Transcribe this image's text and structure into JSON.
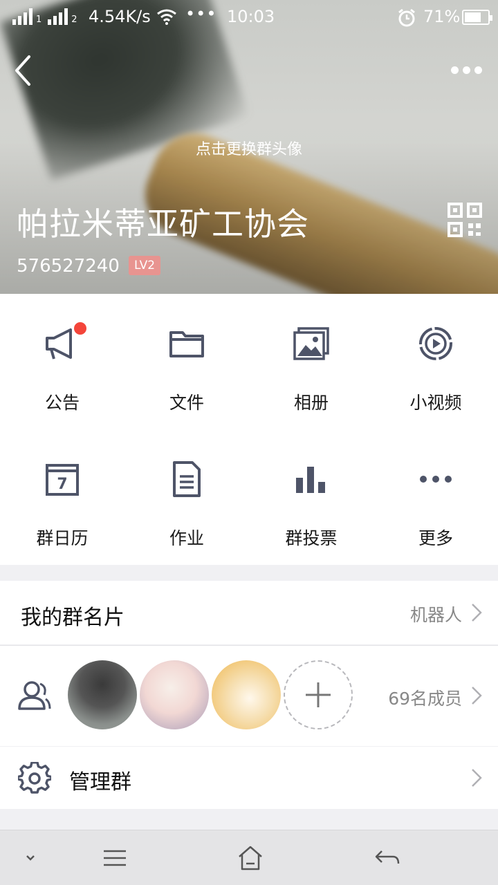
{
  "status_bar": {
    "sim1": "1",
    "sim2": "2",
    "net_speed": "4.54K/s",
    "overflow": "•••",
    "time": "10:03",
    "battery_text": "71%",
    "battery_level": 0.71
  },
  "header": {
    "avatar_hint": "点击更换群头像",
    "group_name": "帕拉米蒂亚矿工协会",
    "group_id": "576527240",
    "level_badge": "LV2"
  },
  "features": [
    {
      "label": "公告",
      "icon": "megaphone-icon",
      "has_badge": true
    },
    {
      "label": "文件",
      "icon": "folder-icon"
    },
    {
      "label": "相册",
      "icon": "album-icon"
    },
    {
      "label": "小视频",
      "icon": "video-icon"
    },
    {
      "label": "群日历",
      "icon": "calendar-icon",
      "calendar_day": "7"
    },
    {
      "label": "作业",
      "icon": "document-icon"
    },
    {
      "label": "群投票",
      "icon": "bar-chart-icon"
    },
    {
      "label": "更多",
      "icon": "more-icon"
    }
  ],
  "my_card": {
    "title": "我的群名片",
    "value": "机器人"
  },
  "members": {
    "count_text": "69名成员"
  },
  "manage": {
    "title": "管理群"
  },
  "colors": {
    "icon": "#4e5468",
    "badge_red": "#f4453a",
    "level_badge_bg": "#e89490"
  }
}
